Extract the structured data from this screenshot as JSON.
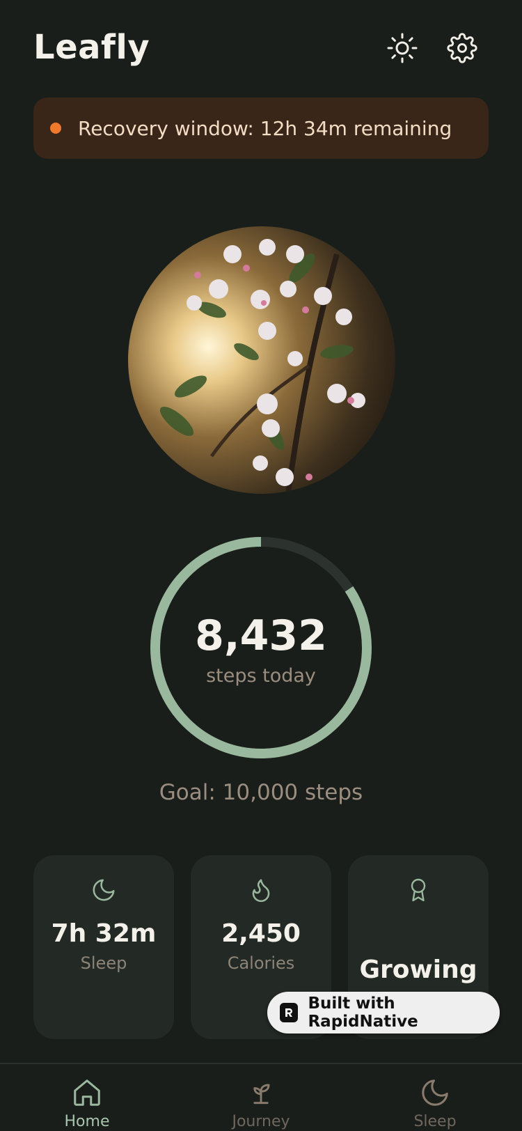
{
  "app": {
    "title": "Leafly"
  },
  "header": {
    "icons": [
      "sun-icon",
      "gear-icon"
    ]
  },
  "banner": {
    "text": "Recovery window: 12h 34m remaining",
    "dot_color": "#f07a2a"
  },
  "steps": {
    "value": "8,432",
    "label": "steps today",
    "goal": "Goal: 10,000 steps",
    "progress": 0.8432
  },
  "stats": [
    {
      "icon": "moon-icon",
      "value": "7h 32m",
      "label": "Sleep"
    },
    {
      "icon": "flame-icon",
      "value": "2,450",
      "label": "Calories"
    },
    {
      "icon": "award-icon",
      "value": "Growing",
      "label": ""
    }
  ],
  "badge": {
    "text": "Built with RapidNative"
  },
  "tabs": [
    {
      "label": "Home",
      "icon": "home-icon",
      "active": true
    },
    {
      "label": "Journey",
      "icon": "sprout-icon",
      "active": false
    },
    {
      "label": "Sleep",
      "icon": "moon-icon",
      "active": false
    }
  ],
  "colors": {
    "accent": "#9ab89e",
    "background": "#1a1e1a",
    "card": "#232924",
    "banner": "#3a2519"
  }
}
